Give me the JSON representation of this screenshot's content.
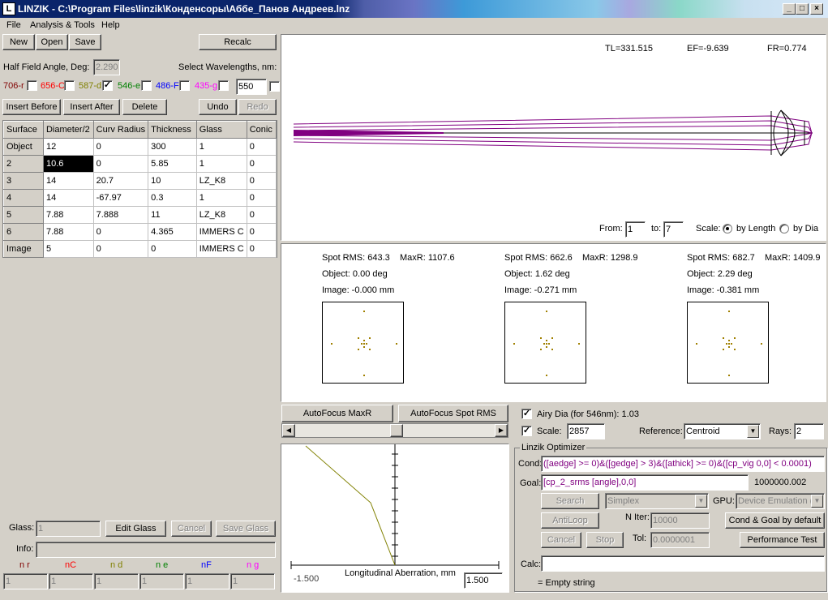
{
  "window": {
    "title": "LINZIK - C:\\Program Files\\linzik\\Конденсоры\\Аббе_Панов Андреев.lnz",
    "icon_letter": "L"
  },
  "menu": [
    "File",
    "Analysis & Tools",
    "Help"
  ],
  "toolbar": {
    "new": "New",
    "open": "Open",
    "save": "Save",
    "recalc": "Recalc"
  },
  "field": {
    "label": "Half Field Angle, Deg:",
    "value": "2.290",
    "wavelength_label": "Select Wavelengths, nm:"
  },
  "wavelengths": [
    {
      "label": "706-r",
      "color": "#800000",
      "checked": false
    },
    {
      "label": "656-C",
      "color": "#ff0000",
      "checked": false
    },
    {
      "label": "587-d",
      "color": "#808000",
      "checked": true
    },
    {
      "label": "546-e",
      "color": "#008000",
      "checked": false
    },
    {
      "label": "486-F",
      "color": "#0000ff",
      "checked": false
    },
    {
      "label": "435-g",
      "color": "#ff00ff",
      "checked": false
    }
  ],
  "custom_wavelength": "550",
  "edit_buttons": {
    "insert_before": "Insert Before",
    "insert_after": "Insert After",
    "delete": "Delete",
    "undo": "Undo",
    "redo": "Redo"
  },
  "table": {
    "headers": [
      "Surface",
      "Diameter/2",
      "Curv Radius",
      "Thickness",
      "Glass",
      "Conic"
    ],
    "rows": [
      [
        "Object",
        "12",
        "0",
        "300",
        "1",
        "0"
      ],
      [
        "2",
        "10.6",
        "0",
        "5.85",
        "1",
        "0"
      ],
      [
        "3",
        "14",
        "20.7",
        "10",
        "LZ_K8",
        "0"
      ],
      [
        "4",
        "14",
        "-67.97",
        "0.3",
        "1",
        "0"
      ],
      [
        "5",
        "7.88",
        "7.888",
        "11",
        "LZ_K8",
        "0"
      ],
      [
        "6",
        "7.88",
        "0",
        "4.365",
        "IMMERS C",
        "0"
      ],
      [
        "Image",
        "5",
        "0",
        "0",
        "IMMERS C",
        "0"
      ]
    ]
  },
  "glass": {
    "label": "Glass:",
    "value": "1",
    "edit": "Edit Glass",
    "cancel": "Cancel",
    "save": "Save Glass",
    "info_label": "Info:"
  },
  "indices": [
    {
      "label": "n r",
      "color": "#800000"
    },
    {
      "label": "nC",
      "color": "#ff0000"
    },
    {
      "label": "n d",
      "color": "#808000"
    },
    {
      "label": "n e",
      "color": "#008000"
    },
    {
      "label": "nF",
      "color": "#0000ff"
    },
    {
      "label": "n g",
      "color": "#ff00ff"
    }
  ],
  "index_values": [
    "1",
    "1",
    "1",
    "1",
    "1",
    "1"
  ],
  "layout": {
    "tl": "TL=331.515",
    "ef": "EF=-9.639",
    "fr": "FR=0.774",
    "from_label": "From:",
    "from_value": "1",
    "to_label": "to:",
    "to_value": "7",
    "scale_label": "Scale:",
    "by_length": "by Length",
    "by_dia": "by Dia",
    "ray_color": "#800080"
  },
  "spots": [
    {
      "rms": "Spot RMS: 643.3",
      "maxr": "MaxR: 1107.6",
      "object": "Object: 0.00 deg",
      "image": "Image: -0.000 mm"
    },
    {
      "rms": "Spot RMS: 662.6",
      "maxr": "MaxR: 1298.9",
      "object": "Object: 1.62 deg",
      "image": "Image: -0.271 mm"
    },
    {
      "rms": "Spot RMS: 682.7",
      "maxr": "MaxR: 1409.9",
      "object": "Object: 2.29 deg",
      "image": "Image: -0.381 mm"
    }
  ],
  "autofocus": {
    "maxr": "AutoFocus MaxR",
    "spot_rms": "AutoFocus Spot RMS"
  },
  "spot_options": {
    "airy_label": "Airy Dia (for 546nm): 1.03",
    "scale_label": "Scale:",
    "scale_value": "2857",
    "reference_label": "Reference:",
    "reference_value": "Centroid",
    "rays_label": "Rays:",
    "rays_value": "2"
  },
  "aberration": {
    "title": "Longitudinal Aberration, mm",
    "left": "-1.500",
    "right": "1.500",
    "curve_color": "#808000"
  },
  "optimizer": {
    "title": "Linzik Optimizer",
    "cond_label": "Cond:",
    "cond_value": "([aedge] >= 0)&([gedge] > 3)&([athick] >= 0)&([cp_vig 0,0] < 0.0001)",
    "goal_label": "Goal:",
    "goal_value": "[cp_2_srms [angle],0,0]",
    "goal_result": "1000000.002",
    "search": "Search",
    "method": "Simplex",
    "gpu_label": "GPU:",
    "gpu_value": "Device Emulation (",
    "antiloop": "AntiLoop",
    "niter_label": "N Iter:",
    "niter_value": "10000",
    "defaults": "Cond & Goal by default",
    "cancel": "Cancel",
    "stop": "Stop",
    "tol_label": "Tol:",
    "tol_value": "0.0000001",
    "perf": "Performance Test",
    "calc_label": "Calc:",
    "calc_value": "",
    "status": "= Empty string"
  }
}
